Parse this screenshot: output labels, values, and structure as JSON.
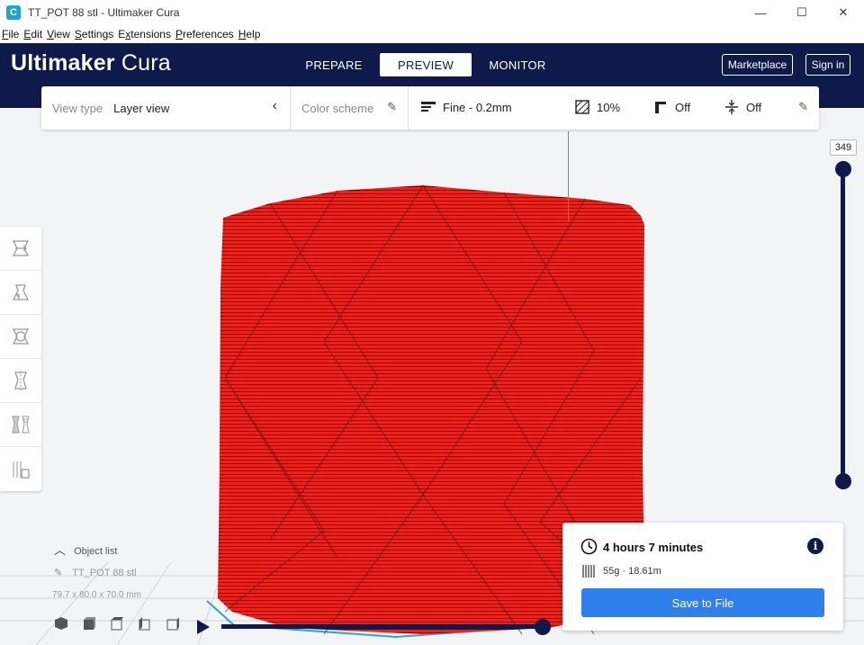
{
  "window": {
    "title": "TT_POT 88 stl - Ultimaker Cura",
    "app_icon": "C",
    "minimize": "—",
    "maximize": "☐",
    "close": "✕"
  },
  "menu": [
    {
      "label": "File",
      "accel": "F",
      "rest": "ile"
    },
    {
      "label": "Edit",
      "accel": "E",
      "rest": "dit"
    },
    {
      "label": "View",
      "accel": "V",
      "rest": "iew"
    },
    {
      "label": "Settings",
      "accel": "S",
      "rest": "ettings"
    },
    {
      "label": "Extensions",
      "accel": "x",
      "rest": "tensions",
      "prefix": "E"
    },
    {
      "label": "Preferences",
      "accel": "P",
      "rest": "references"
    },
    {
      "label": "Help",
      "accel": "H",
      "rest": "elp"
    }
  ],
  "header": {
    "logo_bold": "Ultimaker",
    "logo_light": "Cura",
    "stages": [
      "PREPARE",
      "PREVIEW",
      "MONITOR"
    ],
    "active_stage": "PREVIEW",
    "marketplace": "Marketplace",
    "sign_in": "Sign in"
  },
  "settings_bar": {
    "view_type_label": "View type",
    "view_type_value": "Layer view",
    "color_scheme_label": "Color scheme",
    "profile": "Fine - 0.2mm",
    "infill": "10%",
    "support": "Off",
    "adhesion": "Off"
  },
  "layer_slider": {
    "current_layer": "349",
    "value_fraction": 1.0
  },
  "object_list": {
    "label": "Object list",
    "name": "TT_POT 88 stl",
    "dimensions": "79.7 x 80.0 x 70.0 mm"
  },
  "print_info": {
    "time": "4 hours 7 minutes",
    "material": "55g · 18.61m",
    "save_button": "Save to File"
  },
  "colors": {
    "header": "#0f1a4a",
    "model": "#e8231c",
    "accent": "#2f80ed"
  }
}
